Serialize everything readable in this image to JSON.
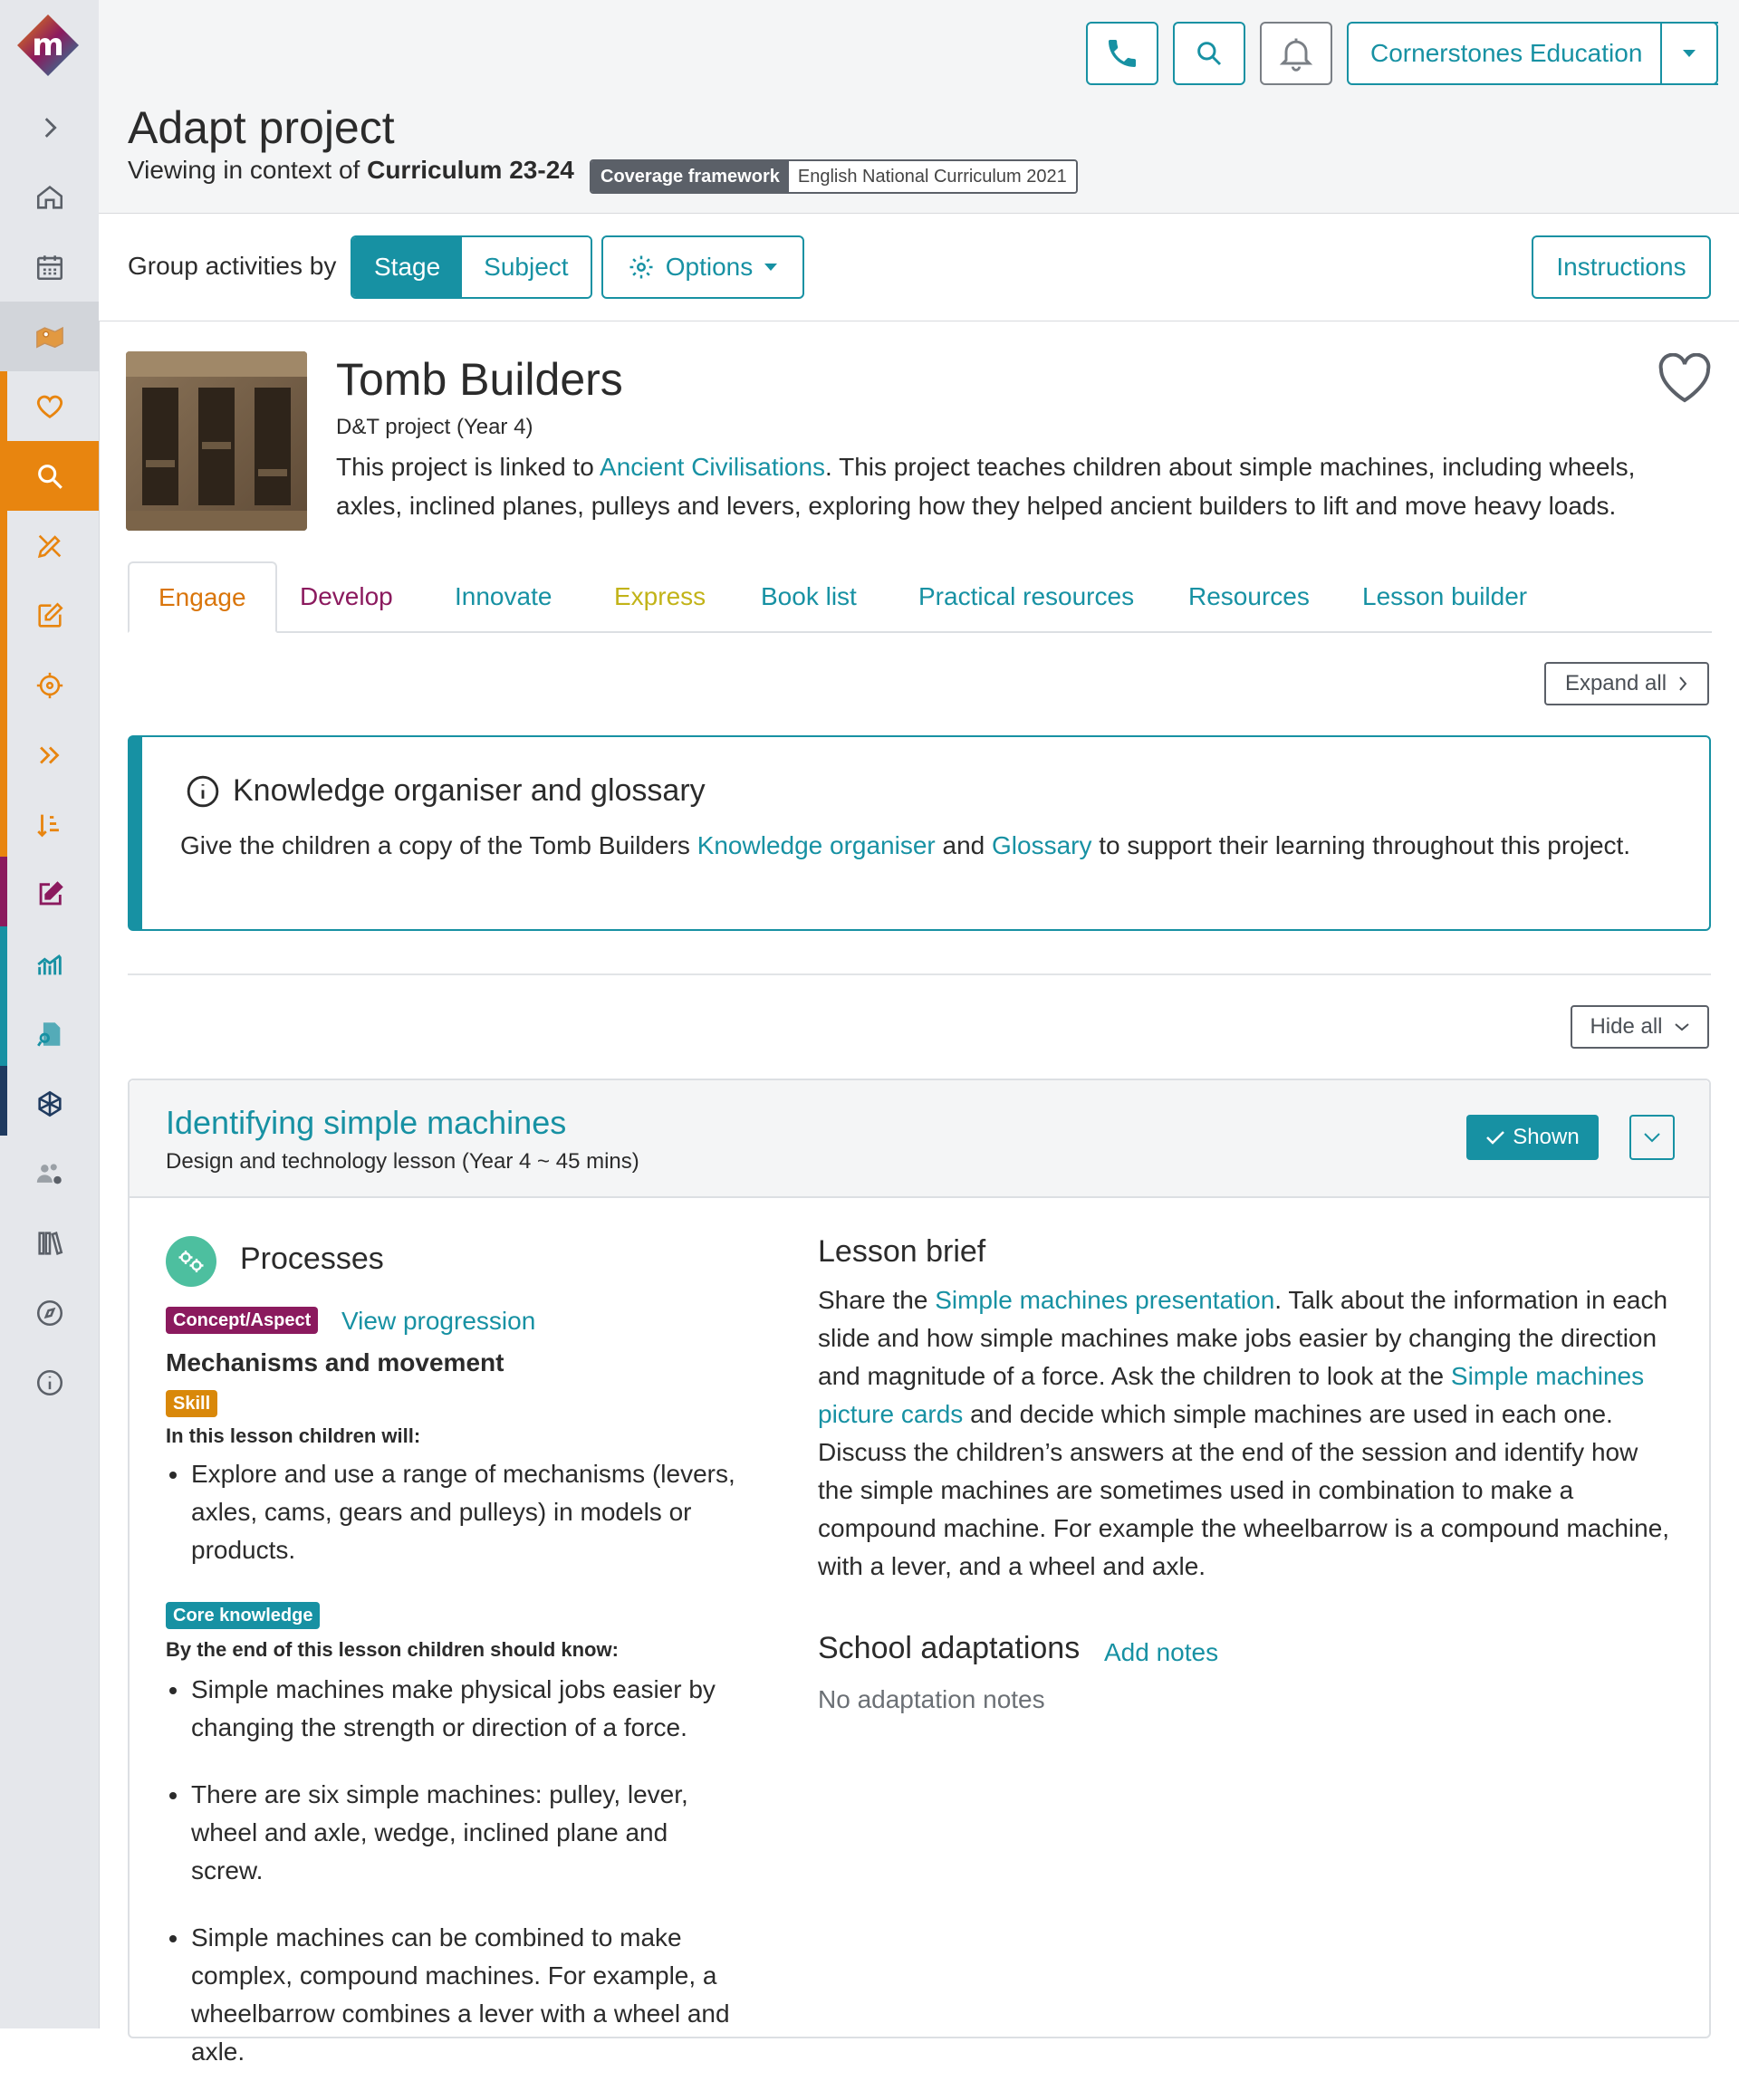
{
  "colors": {
    "accent": "#1791a3",
    "orange": "#e8850f",
    "purple": "#8b1a5e",
    "skill": "#d9880a",
    "core": "#1791a3"
  },
  "sidebar": {
    "items": [
      {
        "icon": "chevron-right-icon"
      },
      {
        "icon": "home-icon"
      },
      {
        "icon": "calendar-icon"
      },
      {
        "icon": "map-icon"
      },
      {
        "icon": "heart-icon"
      },
      {
        "icon": "search-icon"
      },
      {
        "icon": "edit-tools-icon"
      },
      {
        "icon": "edit-icon"
      },
      {
        "icon": "target-icon"
      },
      {
        "icon": "double-chevron-icon"
      },
      {
        "icon": "sort-icon"
      },
      {
        "icon": "pen-square-icon"
      },
      {
        "icon": "chart-icon"
      },
      {
        "icon": "document-search-icon"
      },
      {
        "icon": "network-icon"
      },
      {
        "icon": "users-settings-icon"
      },
      {
        "icon": "library-icon"
      },
      {
        "icon": "compass-icon"
      },
      {
        "icon": "info-icon"
      }
    ]
  },
  "header": {
    "account_label": "Cornerstones Education",
    "page_title": "Adapt project",
    "context_prefix": "Viewing in context of ",
    "context_value": "Curriculum 23-24",
    "framework_label": "Coverage framework",
    "framework_value": "English National Curriculum 2021"
  },
  "toolbar": {
    "group_label": "Group activities by",
    "stage_label": "Stage",
    "subject_label": "Subject",
    "options_label": "Options",
    "instructions_label": "Instructions"
  },
  "project": {
    "title": "Tomb Builders",
    "subtitle": "D&T project (Year 4)",
    "desc_prefix": "This project is linked to ",
    "desc_link": "Ancient Civilisations",
    "desc_suffix": ". This project teaches children about simple machines, including wheels, axles, inclined planes, pulleys and levers, exploring how they helped ancient builders to lift and move heavy loads."
  },
  "tabs": [
    "Engage",
    "Develop",
    "Innovate",
    "Express",
    "Book list",
    "Practical resources",
    "Resources",
    "Lesson builder"
  ],
  "expand_all_label": "Expand all",
  "hide_all_label": "Hide all",
  "knowledge": {
    "title": "Knowledge organiser and glossary",
    "text_prefix": "Give the children a copy of the Tomb Builders ",
    "link1": "Knowledge organiser",
    "text_mid": " and ",
    "link2": "Glossary",
    "text_suffix": " to support their learning throughout this project."
  },
  "lesson": {
    "title": "Identifying simple machines",
    "subtitle": "Design and technology lesson (Year 4 ~ 45 mins)",
    "shown_label": "Shown",
    "processes_title": "Processes",
    "concept_badge": "Concept/Aspect",
    "view_progression": "View progression",
    "concept_value": "Mechanisms and movement",
    "skill_badge": "Skill",
    "skill_label": "In this lesson children will:",
    "skills": [
      "Explore and use a range of mechanisms (levers, axles, cams, gears and pulleys) in models or products."
    ],
    "core_badge": "Core knowledge",
    "core_label": "By the end of this lesson children should know:",
    "core_items": [
      "Simple machines make physical jobs easier by changing the strength or direction of a force.",
      "There are six simple machines: pulley, lever, wheel and axle, wedge, inclined plane and screw.",
      "Simple machines can be combined to make complex, compound machines. For example, a wheelbarrow combines a lever with a wheel and axle."
    ],
    "brief_title": "Lesson brief",
    "brief_prefix": "Share the ",
    "brief_link1": "Simple machines presentation",
    "brief_mid": ". Talk about the information in each slide and how simple machines make jobs easier by changing the direction and magnitude of a force. Ask the children to look at the ",
    "brief_link2": "Simple machines picture cards",
    "brief_suffix": " and decide which simple machines are used in each one. Discuss the children’s answers at the end of the session and identify how the simple machines are sometimes used in combination to make a compound machine. For example the wheelbarrow is a compound machine, with a lever, and a wheel and axle.",
    "adapt_title": "School adaptations",
    "adapt_link": "Add notes",
    "adapt_none": "No adaptation notes"
  }
}
